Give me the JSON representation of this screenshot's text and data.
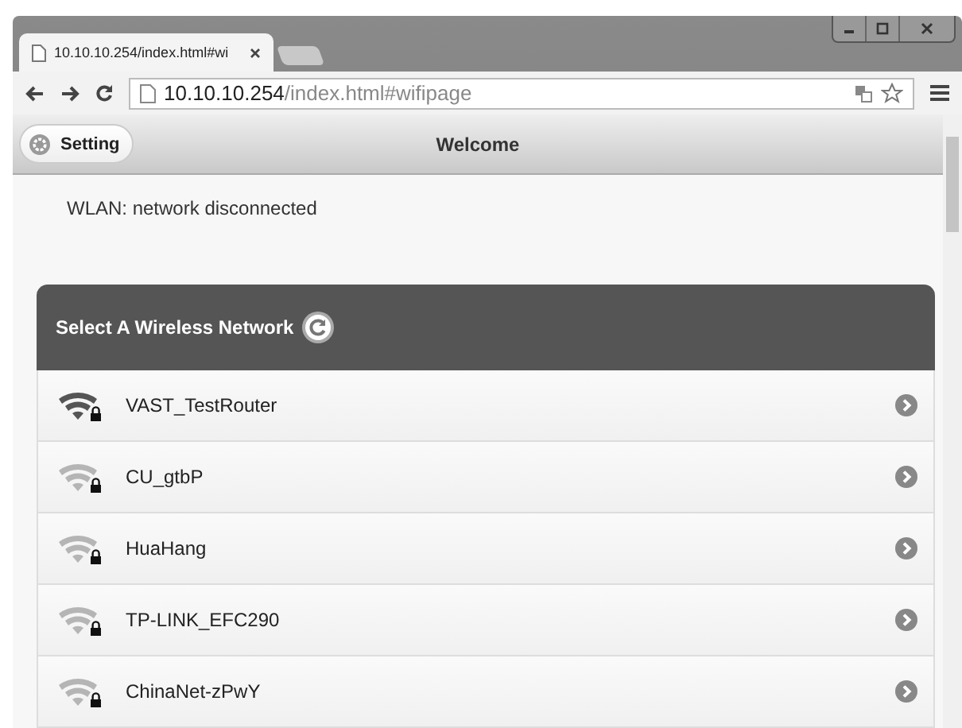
{
  "browser": {
    "tab_title": "10.10.10.254/index.html#wi",
    "url_host": "10.10.10.254",
    "url_path": "/index.html#wifipage"
  },
  "header": {
    "setting_button": "Setting",
    "title": "Welcome"
  },
  "status": "WLAN: network disconnected",
  "network_list": {
    "title": "Select A Wireless Network",
    "items": [
      {
        "name": "VAST_TestRouter",
        "strong_signal": true
      },
      {
        "name": "CU_gtbP",
        "strong_signal": false
      },
      {
        "name": "HuaHang",
        "strong_signal": false
      },
      {
        "name": "TP-LINK_EFC290",
        "strong_signal": false
      },
      {
        "name": "ChinaNet-zPwY",
        "strong_signal": false
      }
    ]
  }
}
